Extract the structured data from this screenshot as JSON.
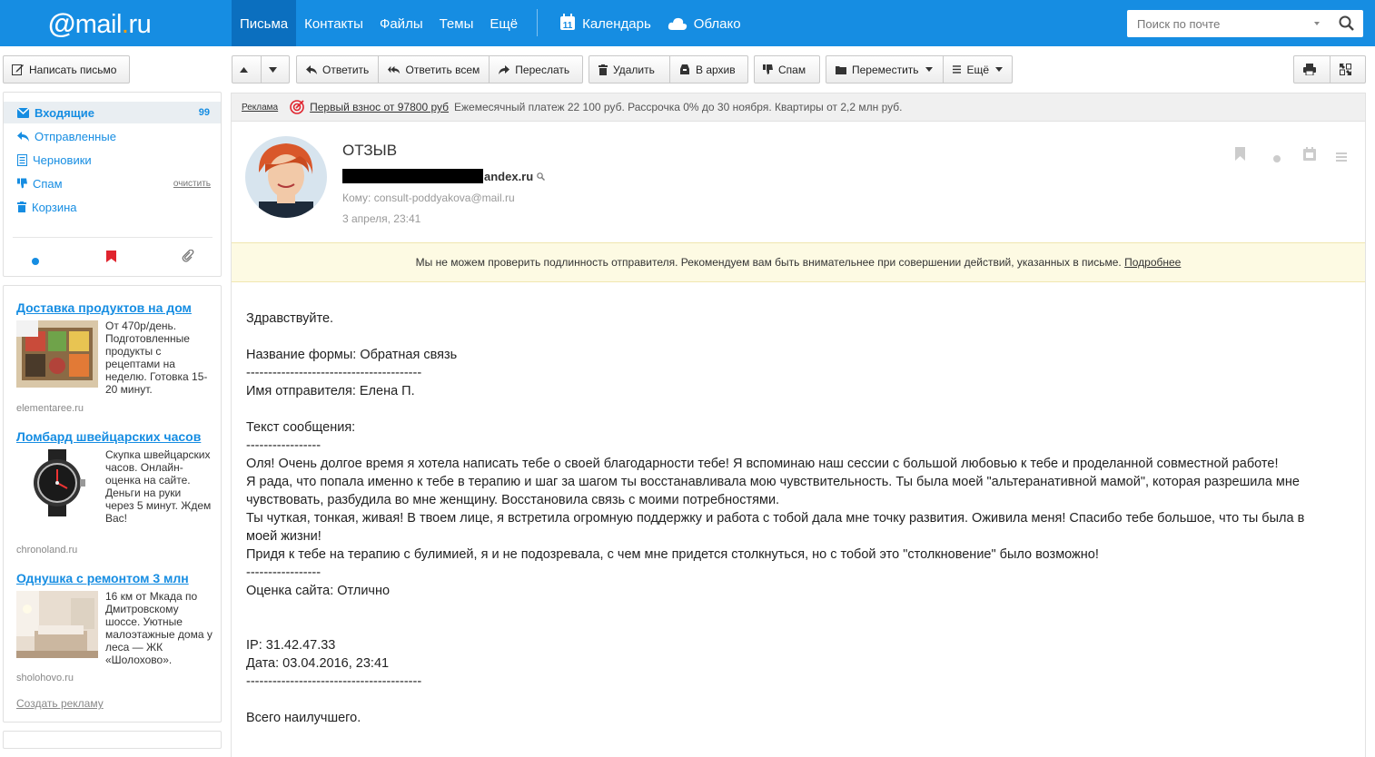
{
  "header": {
    "logo_at": "@",
    "logo_mail": "mail",
    "logo_dot": ".",
    "logo_ru": "ru",
    "nav": [
      "Письма",
      "Контакты",
      "Файлы",
      "Темы",
      "Ещё"
    ],
    "calendar": "Календарь",
    "calendar_day": "11",
    "cloud": "Облако",
    "search_placeholder": "Поиск по почте"
  },
  "toolbar": {
    "compose": "Написать письмо",
    "reply": "Ответить",
    "reply_all": "Ответить всем",
    "forward": "Переслать",
    "delete": "Удалить",
    "archive": "В архив",
    "spam": "Спам",
    "move": "Переместить",
    "more": "Ещё"
  },
  "folders": [
    {
      "label": "Входящие",
      "count": "99"
    },
    {
      "label": "Отправленные"
    },
    {
      "label": "Черновики"
    },
    {
      "label": "Спам",
      "action": "очистить"
    },
    {
      "label": "Корзина"
    }
  ],
  "ads": [
    {
      "title": "Доставка продуктов на дом",
      "text": "От 470р/день. Подготовленные продукты с рецептами на неделю. Готовка 15-20 минут.",
      "domain": "elementaree.ru"
    },
    {
      "title": "Ломбард швейцарских часов",
      "text": "Скупка швейцарских часов. Онлайн-оценка на сайте. Деньги на руки через 5 минут. Ждем Вас!",
      "domain": "chronoland.ru"
    },
    {
      "title": "Однушка с ремонтом 3 млн",
      "text": "16 км от Мкада по Дмитровскому шоссе. Уютные малоэтажные дома у леса — ЖК «Шолохово».",
      "domain": "sholohovo.ru"
    }
  ],
  "ads_create": "Создать рекламу",
  "adbar": {
    "label": "Реклама",
    "link": "Первый взнос от 97800 руб",
    "text": "Ежемесячный платеж 22 100 руб. Рассрочка 0% до 30 ноября. Квартиры от 2,2 млн руб."
  },
  "message": {
    "subject": "ОТЗЫВ",
    "from_visible": "andex.ru",
    "to": "Кому: consult-poddyakova@mail.ru",
    "date": "3 апреля, 23:41",
    "warning": "Мы не можем проверить подлинность отправителя. Рекомендуем вам быть внимательнее при совершении действий, указанных в письме.",
    "warning_link": "Подробнее",
    "body": [
      "Здравствуйте.",
      "",
      "Название формы: Обратная связь",
      "----------------------------------------",
      "Имя отправителя: Елена П.",
      "",
      "Текст сообщения:",
      "-----------------",
      "Оля! Очень долгое время я хотела написать тебе о своей благодарности тебе! Я вспоминаю наш сессии с большой любовью к тебе и проделанной совместной работе!",
      "Я рада, что попала именно к тебе в терапию и шаг за шагом ты восстанавливала мою чувствительность. Ты была моей \"альтеранативной мамой\", которая разрешила мне",
      "чувствовать, разбудила во мне женщину. Восстановила связь с моими потребностями.",
      "Ты чуткая, тонкая, живая! В твоем лице, я встретила огромную поддержку и работа с тобой дала мне точку развития. Оживила меня! Спасибо тебе большое, что ты была в",
      "моей жизни!",
      "Придя к тебе на терапию с булимией, я и не подозревала, с чем мне придется столкнуться, но с тобой это \"столкновение\" было возможно!",
      "-----------------",
      "Оценка сайта: Отлично",
      "",
      "",
      "IP: 31.42.47.33",
      "Дата: 03.04.2016, 23:41",
      "----------------------------------------",
      "",
      "Всего наилучшего."
    ]
  },
  "colors": {
    "brand": "#168de2",
    "active_nav": "#0b6fbf",
    "warning_bg": "#fdfae3",
    "logo_dot": "#ff9e00"
  }
}
